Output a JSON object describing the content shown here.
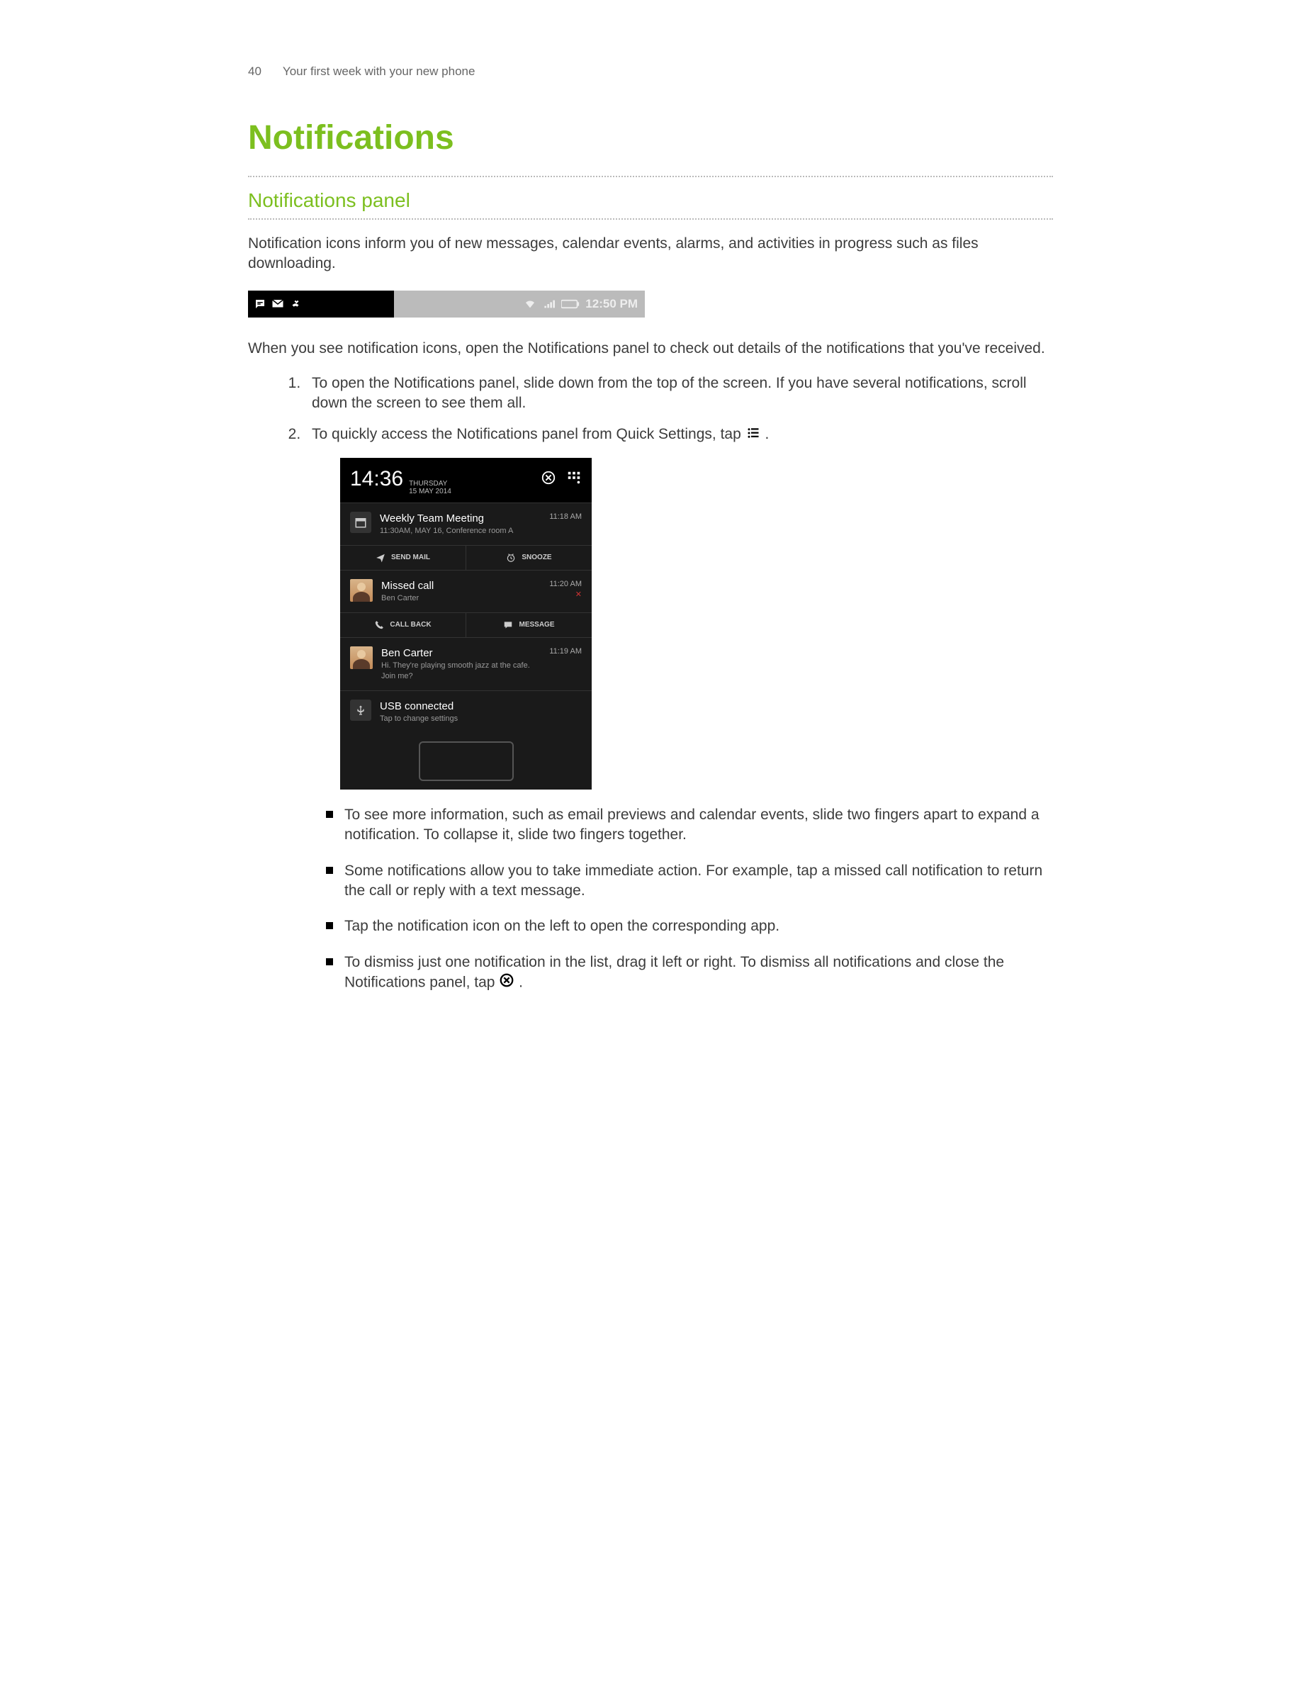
{
  "header": {
    "page_number": "40",
    "section": "Your first week with your new phone"
  },
  "title": "Notifications",
  "subtitle": "Notifications panel",
  "intro": "Notification icons inform you of new messages, calendar events, alarms, and activities in progress such as files downloading.",
  "statusbar": {
    "time": "12:50 PM"
  },
  "after_bar": "When you see notification icons, open the Notifications panel to check out details of the notifications that you've received.",
  "steps": [
    "To open the Notifications panel, slide down from the top of the screen. If you have several notifications, scroll down the screen to see them all.",
    "To quickly access the Notifications panel from Quick Settings, tap"
  ],
  "phone": {
    "clock": "14:36",
    "day": "THURSDAY",
    "date": "15 MAY 2014",
    "items": [
      {
        "icon": "calendar",
        "title": "Weekly Team Meeting",
        "sub": "11:30AM, MAY 16, Conference room A",
        "time": "11:18 AM",
        "actions": [
          "SEND MAIL",
          "SNOOZE"
        ]
      },
      {
        "icon": "avatar",
        "title": "Missed call",
        "sub": "Ben Carter",
        "time": "11:20 AM",
        "actions": [
          "CALL BACK",
          "MESSAGE"
        ]
      },
      {
        "icon": "avatar",
        "title": "Ben Carter",
        "sub": "Hi. They're playing smooth jazz at the cafe. Join me?",
        "time": "11:19 AM"
      },
      {
        "icon": "usb",
        "title": "USB connected",
        "sub": "Tap to change settings"
      }
    ]
  },
  "bullets": [
    "To see more information, such as email previews and calendar events, slide two fingers apart to expand a notification. To collapse it, slide two fingers together.",
    "Some notifications allow you to take immediate action. For example, tap a missed call notification to return the call or reply with a text message.",
    "Tap the notification icon on the left to open the corresponding app.",
    "To dismiss just one notification in the list, drag it left or right. To dismiss all notifications and close the Notifications panel, tap"
  ]
}
